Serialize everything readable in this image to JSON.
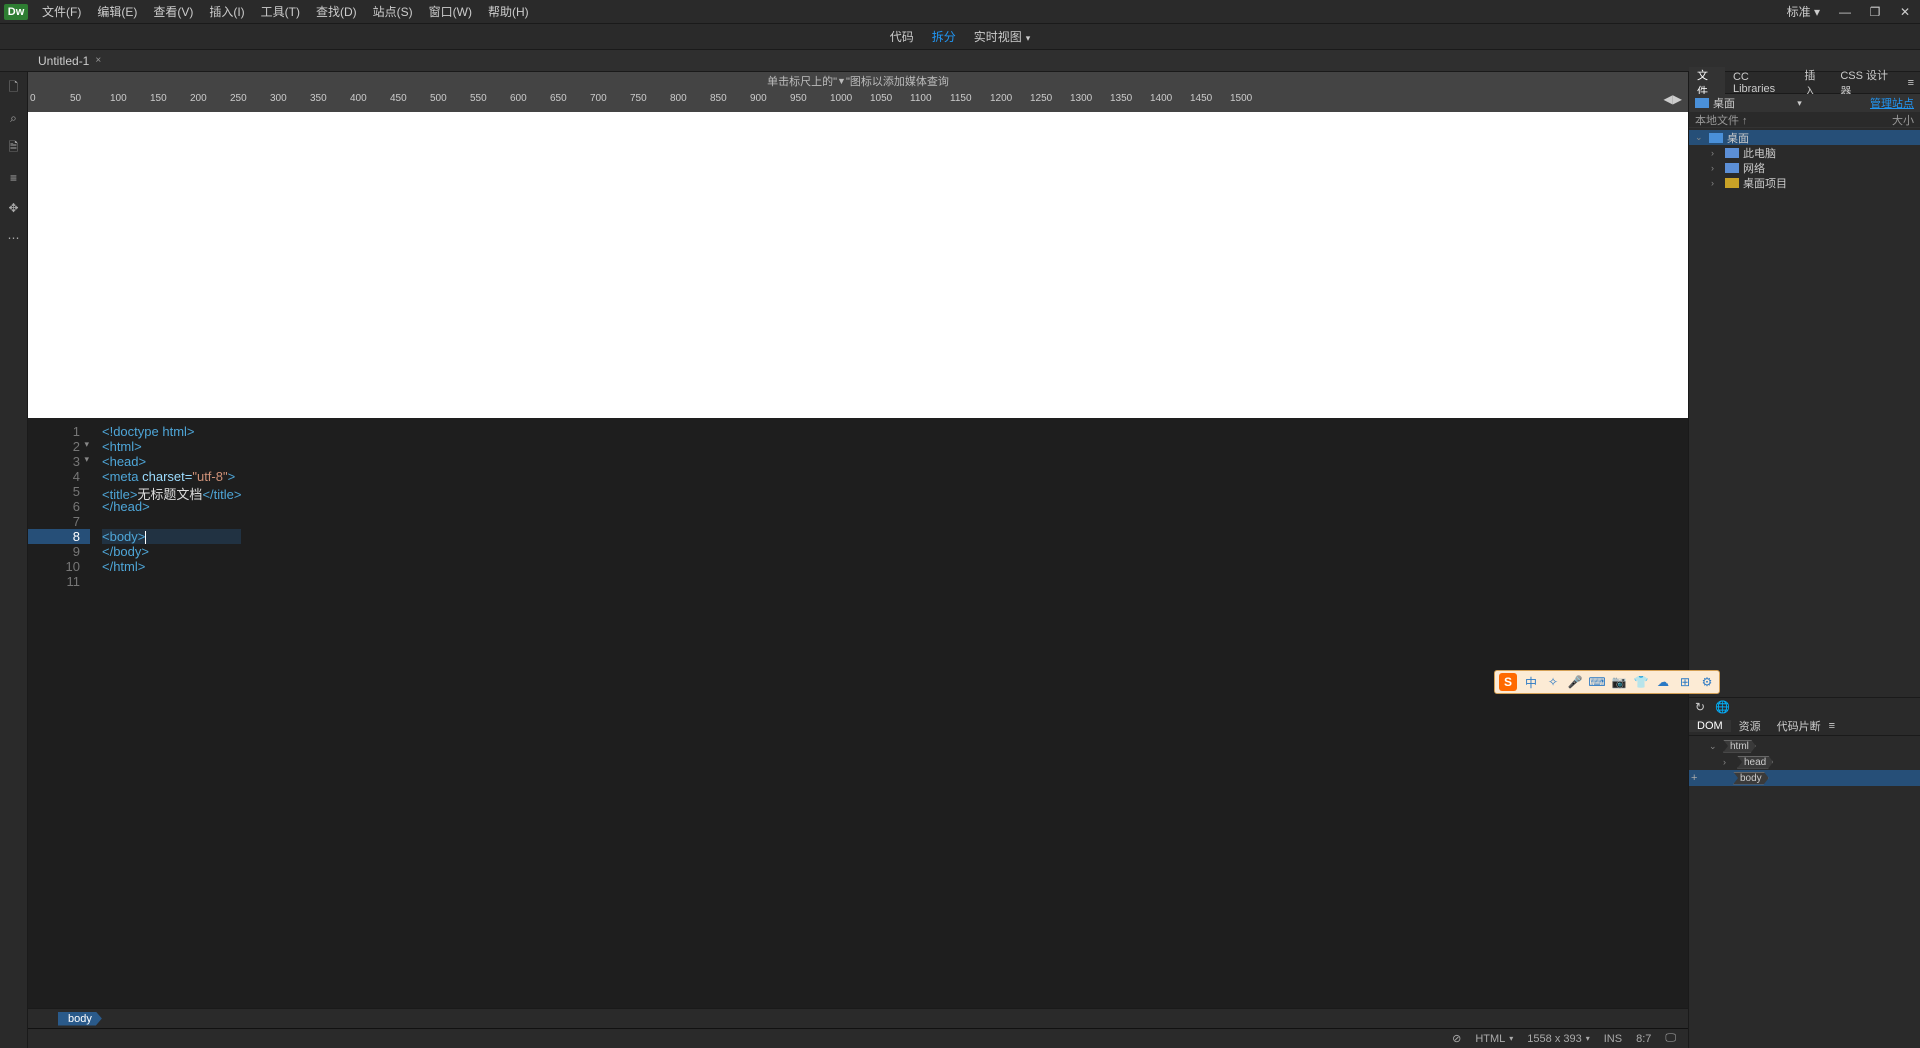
{
  "app": {
    "logo": "Dw"
  },
  "menu": {
    "items": [
      "文件(F)",
      "编辑(E)",
      "查看(V)",
      "插入(I)",
      "工具(T)",
      "查找(D)",
      "站点(S)",
      "窗口(W)",
      "帮助(H)"
    ],
    "standard": "标准",
    "min": "—",
    "max": "❐",
    "close": "✕"
  },
  "view": {
    "code": "代码",
    "split": "拆分",
    "live": "实时视图"
  },
  "tab": {
    "title": "Untitled-1",
    "close": "×"
  },
  "left_tools": [
    "🗋",
    "⌕",
    "🗎",
    "≡",
    "✥",
    "⋯"
  ],
  "ruler_hint_pre": "单击标尺上的\"",
  "ruler_hint_post": "\"图标以添加媒体查询",
  "ruler_marks": [
    "0",
    "50",
    "100",
    "150",
    "200",
    "250",
    "300",
    "350",
    "400",
    "450",
    "500",
    "550",
    "600",
    "650",
    "700",
    "750",
    "800",
    "850",
    "900",
    "950",
    "1000",
    "1050",
    "1100",
    "1150",
    "1200",
    "1250",
    "1300",
    "1350",
    "1400",
    "1450",
    "1500"
  ],
  "code": {
    "lines": [
      "1",
      "2",
      "3",
      "4",
      "5",
      "6",
      "7",
      "8",
      "9",
      "10",
      "11"
    ],
    "folds": {
      "2": "▾",
      "3": "▾"
    },
    "l1_a": "<!doctype html>",
    "l2_a": "<html>",
    "l3_a": "<head>",
    "l4_a": "<meta ",
    "l4_b": "charset=",
    "l4_c": "\"utf-8\"",
    "l4_d": ">",
    "l5_a": "<title>",
    "l5_b": "无标题文档",
    "l5_c": "</title>",
    "l6_a": "</head>",
    "l8_a": "<body>",
    "l9_a": "</body>",
    "l10_a": "</html>"
  },
  "breadcrumb": {
    "body": "body"
  },
  "status": {
    "err": "⊘",
    "lang": "HTML",
    "dim": "1558 x 393",
    "ins": "INS",
    "pos": "8:7",
    "view": "🖵"
  },
  "panels": {
    "files_tab": "文件",
    "cc_tab": "CC Libraries",
    "insert_tab": "插入",
    "css_tab": "CSS 设计器",
    "desktop": "桌面",
    "manage": "管理站点",
    "col_local": "本地文件 ↑",
    "col_size": "大小",
    "tree": {
      "root": "桌面",
      "pc": "此电脑",
      "net": "网络",
      "proj": "桌面项目"
    },
    "dom_tab": "DOM",
    "res_tab": "资源",
    "snip_tab": "代码片断",
    "refresh": "↻",
    "globe": "🌐",
    "dom": {
      "html": "html",
      "head": "head",
      "body": "body"
    },
    "plus": "+"
  },
  "float_icons": [
    "中",
    "✧",
    "🎤",
    "⌨",
    "📷",
    "👕",
    "☁",
    "⊞",
    "⚙"
  ]
}
